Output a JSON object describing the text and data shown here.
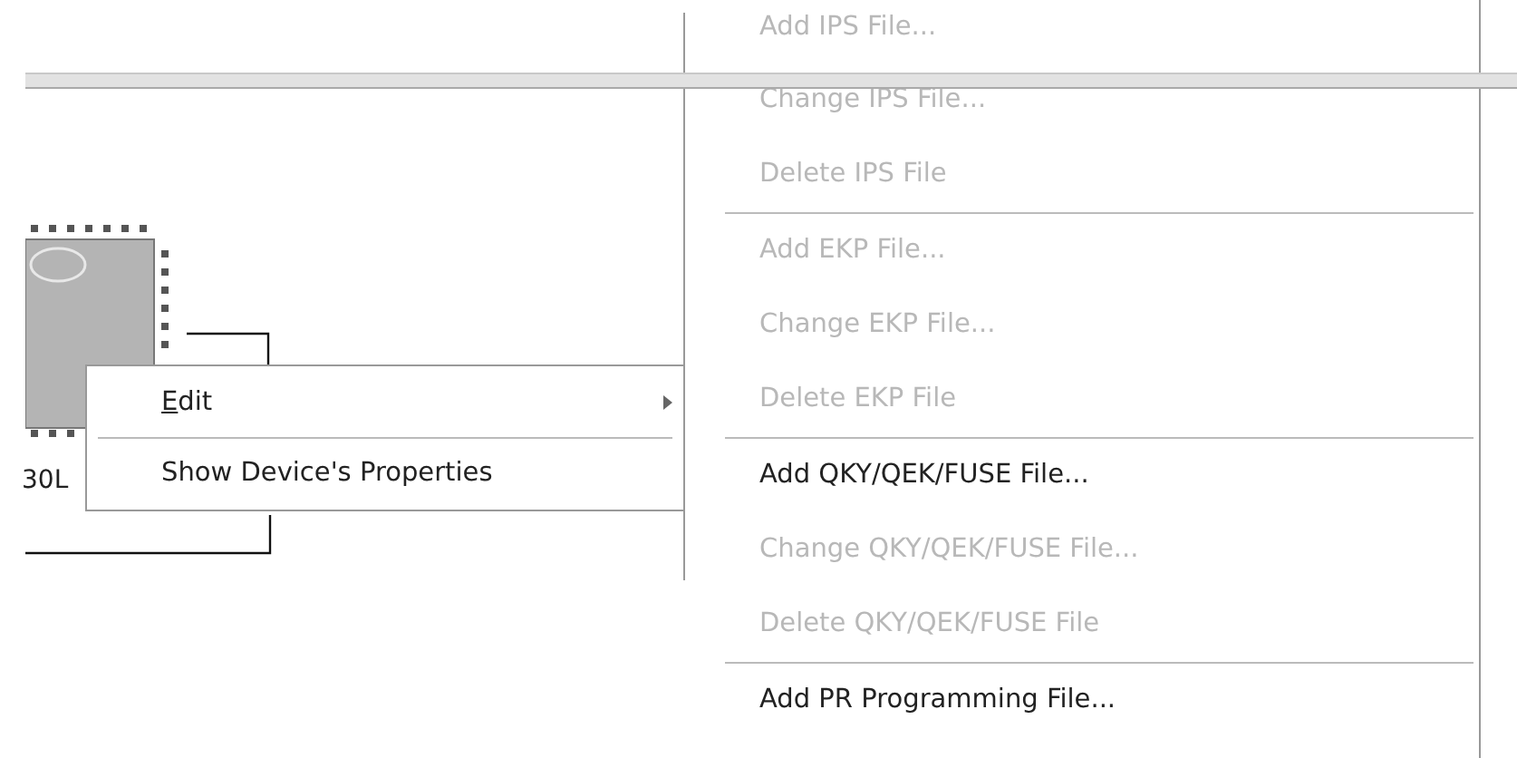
{
  "canvas": {
    "device_label": "30L"
  },
  "context_menu": {
    "items": [
      {
        "label": "Edit",
        "underline_first": true,
        "submenu": true
      },
      {
        "label": "Show Device's Properties",
        "underline_first": false,
        "submenu": false
      }
    ]
  },
  "submenu": {
    "groups": [
      [
        {
          "label": "Add IPS File...",
          "disabled": true
        },
        {
          "label": "Change IPS File...",
          "disabled": true
        },
        {
          "label": "Delete IPS File",
          "disabled": true
        }
      ],
      [
        {
          "label": "Add EKP File...",
          "disabled": true
        },
        {
          "label": "Change EKP File...",
          "disabled": true
        },
        {
          "label": "Delete EKP File",
          "disabled": true
        }
      ],
      [
        {
          "label": "Add QKY/QEK/FUSE File...",
          "disabled": false
        },
        {
          "label": "Change QKY/QEK/FUSE File...",
          "disabled": true
        },
        {
          "label": "Delete QKY/QEK/FUSE File",
          "disabled": true
        }
      ],
      [
        {
          "label": "Add PR Programming File...",
          "disabled": false
        }
      ]
    ]
  }
}
